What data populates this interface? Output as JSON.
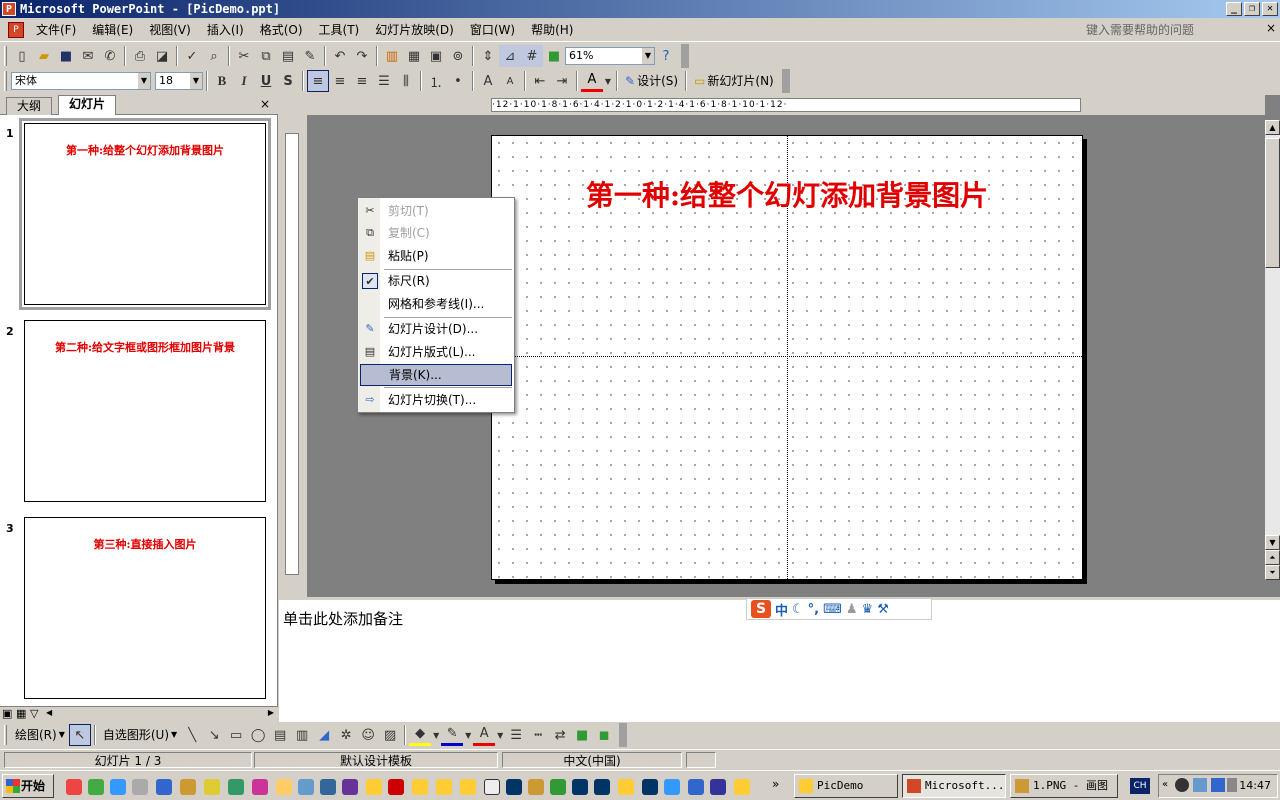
{
  "window": {
    "title": "Microsoft PowerPoint - [PicDemo.ppt]",
    "minimize": "_",
    "restore": "❐",
    "close": "✕"
  },
  "menubar": {
    "items": [
      "文件(F)",
      "编辑(E)",
      "视图(V)",
      "插入(I)",
      "格式(O)",
      "工具(T)",
      "幻灯片放映(D)",
      "窗口(W)",
      "帮助(H)"
    ],
    "help_placeholder": "键入需要帮助的问题",
    "close": "×"
  },
  "standard_toolbar": {
    "zoom": "61%"
  },
  "format_toolbar": {
    "font": "宋体",
    "size": "18",
    "bold": "B",
    "italic": "I",
    "underline": "U",
    "shadow": "S",
    "design_label": "设计(S)",
    "new_slide_label": "新幻灯片(N)"
  },
  "left_pane": {
    "tabs": [
      "大纲",
      "幻灯片"
    ],
    "active_tab": "幻灯片",
    "close": "×",
    "slides": [
      {
        "num": "1",
        "title": "第一种:给整个幻灯添加背景图片"
      },
      {
        "num": "2",
        "title": "第二种:给文字框或图形框加图片背景"
      },
      {
        "num": "3",
        "title": "第三种:直接插入图片"
      }
    ]
  },
  "ruler": {
    "h_labels": "·12·1·10·1·8·1·6·1·4·1·2·1·0·1·2·1·4·1·6·1·8·1·10·1·12·"
  },
  "slide": {
    "title": "第一种:给整个幻灯添加背景图片",
    "title_color": "#e00000"
  },
  "notes": {
    "placeholder": "单击此处添加备注"
  },
  "ime": {
    "logo": "S",
    "mode": "中"
  },
  "context_menu": {
    "items": [
      {
        "label": "剪切(T)",
        "enabled": false
      },
      {
        "label": "复制(C)",
        "enabled": false
      },
      {
        "label": "粘贴(P)",
        "enabled": true
      },
      {
        "label": "标尺(R)",
        "enabled": true,
        "checked": true
      },
      {
        "label": "网格和参考线(I)...",
        "enabled": true
      },
      {
        "label": "幻灯片设计(D)...",
        "enabled": true
      },
      {
        "label": "幻灯片版式(L)...",
        "enabled": true
      },
      {
        "label": "背景(K)...",
        "enabled": true,
        "highlighted": true
      },
      {
        "label": "幻灯片切换(T)...",
        "enabled": true
      }
    ]
  },
  "drawing_toolbar": {
    "draw_label": "绘图(R)",
    "autoshapes_label": "自选图形(U)"
  },
  "statusbar": {
    "slide_info": "幻灯片 1 / 3",
    "template": "默认设计模板",
    "language": "中文(中国)"
  },
  "taskbar": {
    "start": "开始",
    "tasks": [
      {
        "label": "PicDemo",
        "active": false
      },
      {
        "label": "Microsoft...",
        "active": true
      },
      {
        "label": "1.PNG - 画图",
        "active": false
      }
    ],
    "lang": "CH",
    "clock": "14:47"
  }
}
